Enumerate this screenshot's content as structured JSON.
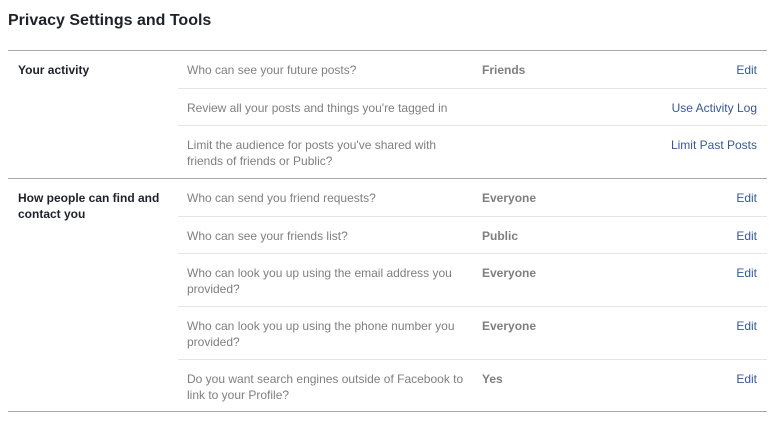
{
  "page": {
    "title": "Privacy Settings and Tools"
  },
  "sections": [
    {
      "label": "Your activity",
      "rows": [
        {
          "question": "Who can see your future posts?",
          "value": "Friends",
          "action": "Edit"
        },
        {
          "question": "Review all your posts and things you're tagged in",
          "value": "",
          "action": "Use Activity Log"
        },
        {
          "question": "Limit the audience for posts you've shared with friends of friends or Public?",
          "value": "",
          "action": "Limit Past Posts"
        }
      ]
    },
    {
      "label": "How people can find and contact you",
      "rows": [
        {
          "question": "Who can send you friend requests?",
          "value": "Everyone",
          "action": "Edit"
        },
        {
          "question": "Who can see your friends list?",
          "value": "Public",
          "action": "Edit"
        },
        {
          "question": "Who can look you up using the email address you provided?",
          "value": "Everyone",
          "action": "Edit"
        },
        {
          "question": "Who can look you up using the phone number you provided?",
          "value": "Everyone",
          "action": "Edit"
        },
        {
          "question": "Do you want search engines outside of Facebook to link to your Profile?",
          "value": "Yes",
          "action": "Edit"
        }
      ]
    }
  ]
}
